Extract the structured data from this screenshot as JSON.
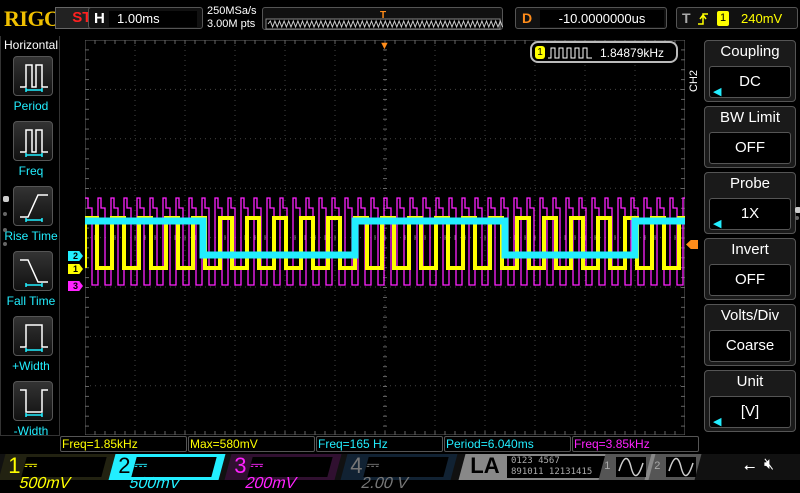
{
  "brand": "RIGOL",
  "run_state": "STOP",
  "horizontal": {
    "key": "H",
    "timebase": "1.00ms",
    "sample_rate": "250MSa/s",
    "memory_depth": "3.00M pts"
  },
  "delay": {
    "key": "D",
    "value": "-10.0000000us"
  },
  "trigger": {
    "key": "T",
    "edge": "rising",
    "source": "1",
    "level": "240mV"
  },
  "freq_counter": {
    "channel": "1",
    "value": "1.84879kHz"
  },
  "left_menu": {
    "title": "Horizontal",
    "items": [
      {
        "label": "Period",
        "icon": "period-icon"
      },
      {
        "label": "Freq",
        "icon": "freq-icon"
      },
      {
        "label": "Rise Time",
        "icon": "rise-time-icon"
      },
      {
        "label": "Fall Time",
        "icon": "fall-time-icon"
      },
      {
        "label": "+Width",
        "icon": "pos-width-icon"
      },
      {
        "label": "-Width",
        "icon": "neg-width-icon"
      }
    ]
  },
  "right_menu": {
    "channel": "CH2",
    "items": [
      {
        "label": "Coupling",
        "value": "DC",
        "arrow": true
      },
      {
        "label": "BW Limit",
        "value": "OFF",
        "arrow": false
      },
      {
        "label": "Probe",
        "value": "1X",
        "arrow": true
      },
      {
        "label": "Invert",
        "value": "OFF",
        "arrow": false
      },
      {
        "label": "Volts/Div",
        "value": "Coarse",
        "arrow": false
      },
      {
        "label": "Unit",
        "value": "[V]",
        "arrow": true
      }
    ]
  },
  "measurements": [
    {
      "text": "Freq=1.85kHz",
      "color": "#ffff00"
    },
    {
      "text": "Max=580mV",
      "color": "#ffff00"
    },
    {
      "text": "Freq=165 Hz",
      "color": "#22eeff"
    },
    {
      "text": "Period=6.040ms",
      "color": "#22eeff"
    },
    {
      "text": "Freq=3.85kHz",
      "color": "#ff22ff"
    }
  ],
  "channels": [
    {
      "num": "1",
      "scale": "500mV",
      "color": "#ffff00",
      "active": true
    },
    {
      "num": "2",
      "scale": "500mV",
      "color": "#22eeff",
      "active": true
    },
    {
      "num": "3",
      "scale": "200mV",
      "color": "#ff22ff",
      "active": true
    },
    {
      "num": "4",
      "scale": "2.00 V",
      "color": "#777777",
      "active": false
    }
  ],
  "la": {
    "label": "LA",
    "bits_top": "0123 4567",
    "bits_bottom": "891011 12131415"
  },
  "gen": [
    "1",
    "2"
  ],
  "colors": {
    "ch1": "#ffff00",
    "ch2": "#22eeff",
    "ch3": "#ff22ff",
    "trigger": "#ff8c1a"
  }
}
